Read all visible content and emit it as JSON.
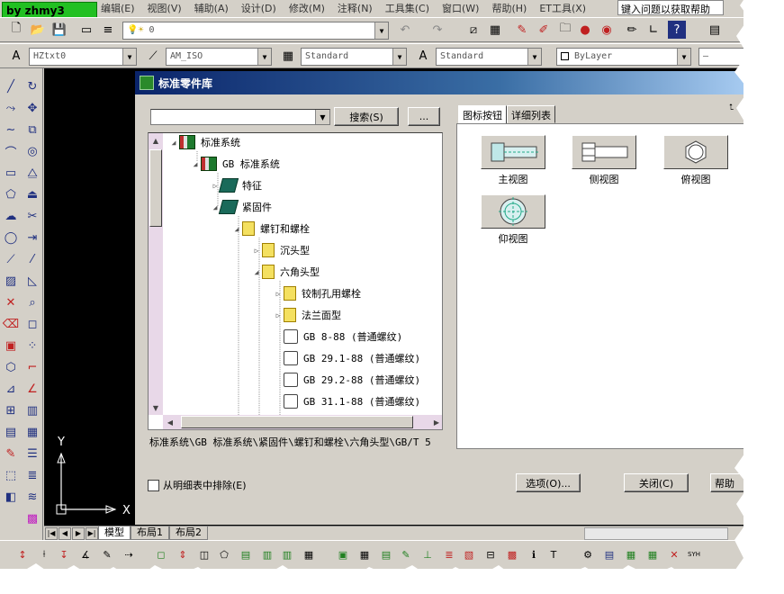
{
  "badge": "by zhmy3",
  "menu": [
    "编辑(E)",
    "视图(V)",
    "辅助(A)",
    "设计(D)",
    "修改(M)",
    "注释(N)",
    "工具集(C)",
    "窗口(W)",
    "帮助(H)",
    "ET工具(X)"
  ],
  "help_placeholder": "键入问题以获取帮助",
  "layer_value": "0",
  "style_combos": {
    "text_style": "HZtxt0",
    "dim_style": "AM_ISO",
    "table_style": "Standard",
    "mleader_style": "Standard",
    "color": "ByLayer"
  },
  "dialog": {
    "title": "标准零件库",
    "search_button": "搜索(S)",
    "more_button": "...",
    "tree": [
      {
        "label": "标准系统",
        "icon": "library-icon",
        "level": 0,
        "expanded": true
      },
      {
        "label": "GB 标准系统",
        "icon": "library-icon",
        "level": 1,
        "expanded": true
      },
      {
        "label": "特征",
        "icon": "book-icon",
        "level": 2,
        "expanded": false
      },
      {
        "label": "紧固件",
        "icon": "book-icon",
        "level": 2,
        "expanded": true
      },
      {
        "label": "螺钉和螺栓",
        "icon": "folder-icon",
        "level": 3,
        "expanded": true
      },
      {
        "label": "沉头型",
        "icon": "folder-icon",
        "level": 4,
        "expanded": false
      },
      {
        "label": "六角头型",
        "icon": "folder-icon",
        "level": 4,
        "expanded": true
      },
      {
        "label": "铰制孔用螺栓",
        "icon": "folder-icon",
        "level": 5,
        "expanded": false
      },
      {
        "label": "法兰面型",
        "icon": "folder-icon",
        "level": 5,
        "expanded": false
      },
      {
        "label": "GB 8-88  (普通螺纹)",
        "icon": "part-icon",
        "level": 5
      },
      {
        "label": "GB 29.1-88  (普通螺纹)",
        "icon": "part-icon",
        "level": 5
      },
      {
        "label": "GB 29.2-88  (普通螺纹)",
        "icon": "part-icon",
        "level": 5
      },
      {
        "label": "GB 31.1-88  (普通螺纹)",
        "icon": "part-icon",
        "level": 5
      }
    ],
    "path": "标准系统\\GB 标准系统\\紧固件\\螺钉和螺栓\\六角头型\\GB/T 5",
    "tabs": [
      "图标按钮",
      "详细列表"
    ],
    "views": [
      "主视图",
      "侧视图",
      "俯视图",
      "仰视图"
    ],
    "exclude_checkbox": "从明细表中排除(E)",
    "options_button": "选项(O)...",
    "close_button": "关闭(C)",
    "help_button": "帮助"
  },
  "layout_tabs": [
    "模型",
    "布局1",
    "布局2"
  ],
  "ucs": {
    "x": "X",
    "y": "Y"
  }
}
